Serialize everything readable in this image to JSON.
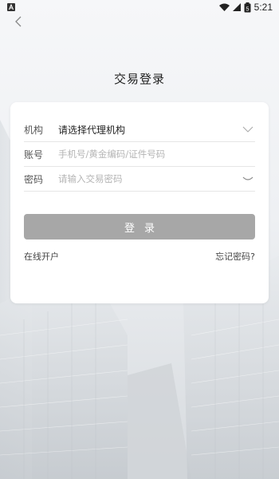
{
  "status_bar": {
    "time": "5:21",
    "battery_level": "5",
    "icons": [
      "notification-a-icon",
      "wifi-icon",
      "cellular-signal-icon",
      "battery-icon"
    ]
  },
  "header": {
    "back_icon": "chevron-left-icon",
    "title": "交易登录"
  },
  "form": {
    "org": {
      "label": "机构",
      "value": "请选择代理机构",
      "icon": "chevron-down-icon"
    },
    "account": {
      "label": "账号",
      "placeholder": "手机号/黄金编码/证件号码"
    },
    "password": {
      "label": "密码",
      "placeholder": "请输入交易密码",
      "icon": "eye-closed-icon"
    }
  },
  "actions": {
    "login_label": "登录",
    "open_account": "在线开户",
    "forgot_password": "忘记密码?"
  },
  "colors": {
    "login_button_bg": "#a7a7a7",
    "card_bg": "#ffffff",
    "page_bg": "#f3f4f6"
  }
}
